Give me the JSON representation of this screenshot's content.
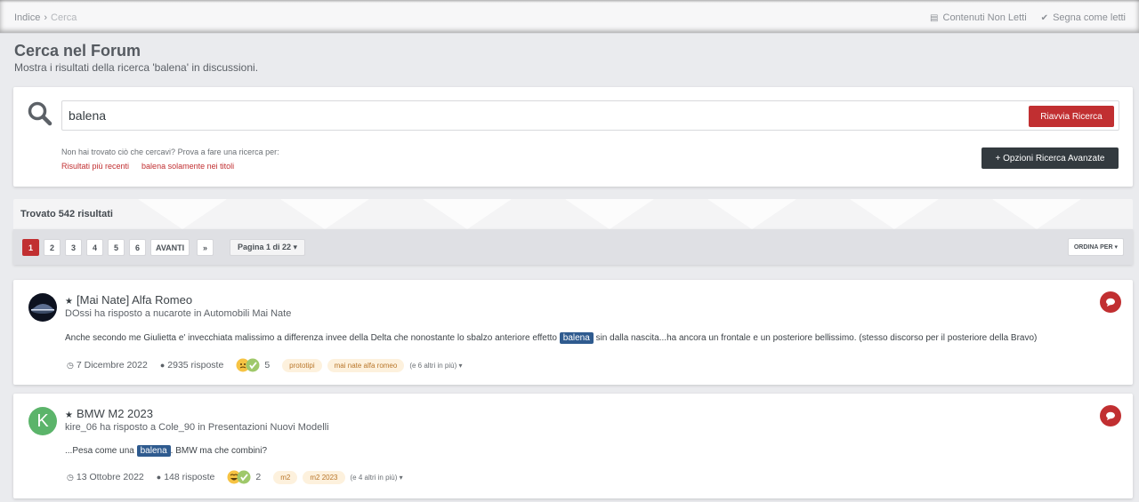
{
  "breadcrumb": {
    "home": "Indice",
    "current": "Cerca"
  },
  "topnav": {
    "unread": "Contenuti Non Letti",
    "mark_read": "Segna come letti"
  },
  "page": {
    "title": "Cerca nel Forum",
    "subtitle": "Mostra i risultati della ricerca 'balena' in discussioni."
  },
  "search": {
    "value": "balena",
    "restart_label": "Riavvia Ricerca",
    "hint": "Non hai trovato ciò che cercavi? Prova a fare una ricerca per:",
    "link_recent": "Risultati più recenti",
    "link_titles": "balena solamente nei titoli",
    "advanced_label": "+ Opzioni Ricerca Avanzate"
  },
  "results": {
    "count_label": "Trovato 542 risultati",
    "pages": [
      "1",
      "2",
      "3",
      "4",
      "5",
      "6"
    ],
    "next_label": "AVANTI",
    "last_label": "»",
    "page_select": "Pagina 1 di 22 ▾",
    "order_label": "ORDINA PER ▾"
  },
  "posts": [
    {
      "title": "[Mai Nate] Alfa Romeo",
      "meta": "DOssi ha risposto a nucarote in Automobili Mai Nate",
      "snippet_before": "Anche secondo me Giulietta e' invecchiata malissimo a differenza invee della Delta che nonostante lo sbalzo anteriore effetto",
      "snippet_hl": "balena",
      "snippet_after": "sin dalla nascita...ha ancora un frontale e un posteriore bellissimo. (stesso discorso per il posteriore della Bravo)",
      "date": "7 Dicembre 2022",
      "replies": "2935 risposte",
      "reactions": "5",
      "tags": [
        "prototipi",
        "mai nate alfa romeo"
      ],
      "more_tags": "(e 6 altri in più) ▾",
      "avatar_letter": ""
    },
    {
      "title": "BMW M2 2023",
      "meta": "kire_06 ha risposto a Cole_90 in Presentazioni Nuovi Modelli",
      "snippet_before": "...Pesa come una",
      "snippet_hl": "balena",
      "snippet_after": ". BMW ma che combini?",
      "date": "13 Ottobre 2022",
      "replies": "148 risposte",
      "reactions": "2",
      "tags": [
        "m2",
        "m2 2023"
      ],
      "more_tags": "(e 4 altri in più) ▾",
      "avatar_letter": "K"
    }
  ]
}
